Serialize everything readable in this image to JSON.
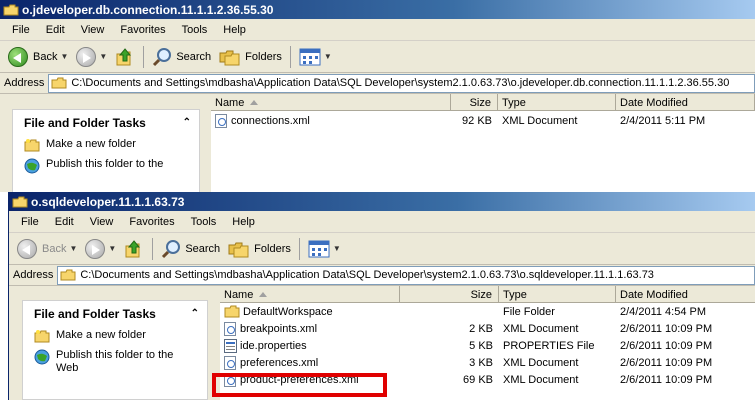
{
  "window1": {
    "title": "o.jdeveloper.db.connection.11.1.1.2.36.55.30",
    "menu": [
      "File",
      "Edit",
      "View",
      "Favorites",
      "Tools",
      "Help"
    ],
    "toolbar": {
      "back": "Back",
      "search": "Search",
      "folders": "Folders"
    },
    "address_label": "Address",
    "address": "C:\\Documents and Settings\\mdbasha\\Application Data\\SQL Developer\\system2.1.0.63.73\\o.jdeveloper.db.connection.11.1.1.2.36.55.30",
    "tasks": {
      "header": "File and Folder Tasks",
      "items": [
        "Make a new folder",
        "Publish this folder to the"
      ]
    },
    "columns": {
      "name": "Name",
      "size": "Size",
      "type": "Type",
      "date": "Date Modified"
    },
    "files": [
      {
        "name": "connections.xml",
        "size": "92 KB",
        "type": "XML Document",
        "date": "2/4/2011 5:11 PM",
        "icon": "xml-icon"
      }
    ]
  },
  "window2": {
    "title": "o.sqldeveloper.11.1.1.63.73",
    "menu": [
      "File",
      "Edit",
      "View",
      "Favorites",
      "Tools",
      "Help"
    ],
    "toolbar": {
      "back": "Back",
      "search": "Search",
      "folders": "Folders"
    },
    "address_label": "Address",
    "address": "C:\\Documents and Settings\\mdbasha\\Application Data\\SQL Developer\\system2.1.0.63.73\\o.sqldeveloper.11.1.1.63.73",
    "tasks": {
      "header": "File and Folder Tasks",
      "items": [
        "Make a new folder",
        "Publish this folder to the Web"
      ]
    },
    "columns": {
      "name": "Name",
      "size": "Size",
      "type": "Type",
      "date": "Date Modified"
    },
    "files": [
      {
        "name": "DefaultWorkspace",
        "size": "",
        "type": "File Folder",
        "date": "2/4/2011 4:54 PM",
        "icon": "folder-icon"
      },
      {
        "name": "breakpoints.xml",
        "size": "2 KB",
        "type": "XML Document",
        "date": "2/6/2011 10:09 PM",
        "icon": "xml-icon"
      },
      {
        "name": "ide.properties",
        "size": "5 KB",
        "type": "PROPERTIES File",
        "date": "2/6/2011 10:09 PM",
        "icon": "properties-file-icon"
      },
      {
        "name": "preferences.xml",
        "size": "3 KB",
        "type": "XML Document",
        "date": "2/6/2011 10:09 PM",
        "icon": "xml-icon"
      },
      {
        "name": "product-preferences.xml",
        "size": "69 KB",
        "type": "XML Document",
        "date": "2/6/2011 10:09 PM",
        "icon": "xml-icon"
      }
    ]
  },
  "colors": {
    "titlebar": "#0a246a",
    "highlight": "#e00000"
  }
}
